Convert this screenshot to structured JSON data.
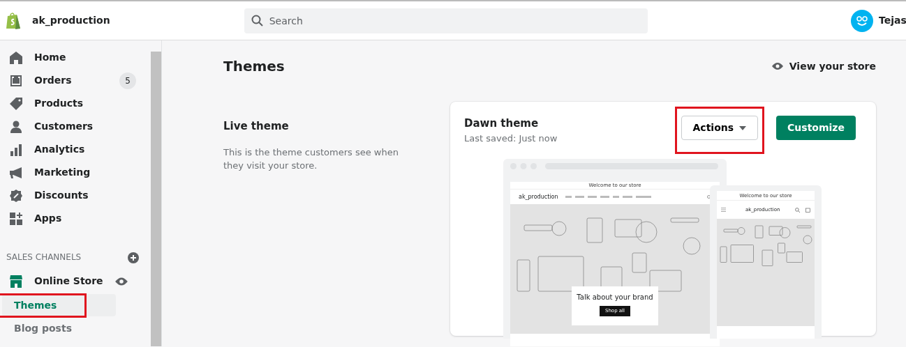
{
  "topbar": {
    "store_name": "ak_production",
    "search": {
      "placeholder": "Search"
    },
    "user": "Tejas"
  },
  "sidebar": {
    "items": [
      {
        "label": "Home"
      },
      {
        "label": "Orders",
        "badge": "5"
      },
      {
        "label": "Products"
      },
      {
        "label": "Customers"
      },
      {
        "label": "Analytics"
      },
      {
        "label": "Marketing"
      },
      {
        "label": "Discounts"
      },
      {
        "label": "Apps"
      }
    ],
    "section_title": "SALES CHANNELS",
    "channel": {
      "label": "Online Store",
      "children": [
        {
          "label": "Themes",
          "selected": true,
          "highlighted": true
        },
        {
          "label": "Blog posts",
          "selected": false,
          "highlighted": false
        }
      ]
    }
  },
  "page": {
    "title": "Themes",
    "view_store": "View your store",
    "live_theme": {
      "title": "Live theme",
      "description": "This is the theme customers see when they visit your store."
    },
    "card": {
      "theme_name": "Dawn theme",
      "last_saved": "Last saved: Just now",
      "buttons": [
        {
          "label": "Actions",
          "kind": "dropdown",
          "highlighted": true
        },
        {
          "label": "Customize",
          "kind": "primary",
          "highlighted": false
        }
      ],
      "preview": {
        "desktop": {
          "announcement": "Welcome to our store",
          "logo": "ak_production",
          "banner_title": "Talk about your brand",
          "banner_button": "Shop all"
        },
        "mobile": {
          "announcement": "Welcome to our store",
          "logo": "ak_production"
        }
      }
    }
  }
}
